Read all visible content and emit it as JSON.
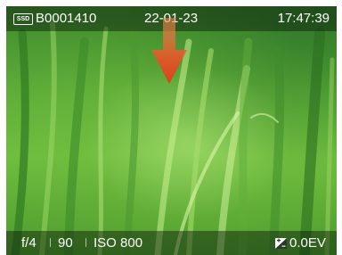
{
  "overlay": {
    "media_badge": "SSD",
    "clip_name": "B0001410",
    "date": "22-01-23",
    "time": "17:47:39",
    "aperture": "f/4",
    "shutter": "90",
    "iso": "ISO 800",
    "exposure_comp": "0.0EV"
  },
  "icons": {
    "media": "ssd-icon",
    "exposure": "exposure-compensation-icon",
    "arrow": "down-arrow-icon"
  },
  "colors": {
    "arrow": "#e8552a",
    "bar": "#0a190a"
  }
}
